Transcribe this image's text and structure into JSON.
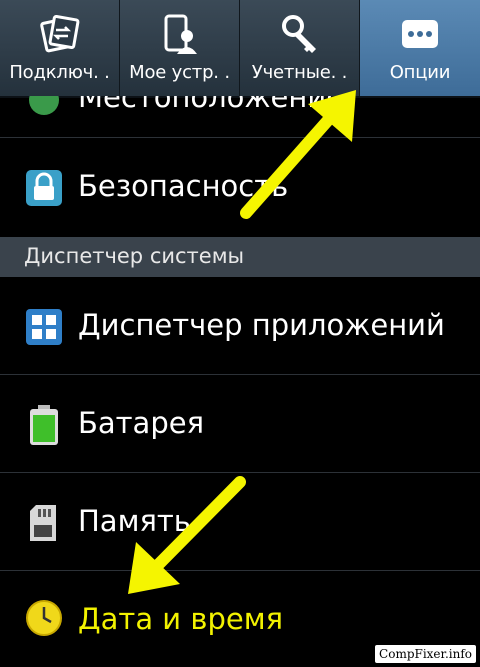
{
  "tabs": [
    {
      "label": "Подключ. .",
      "icon": "connections-icon"
    },
    {
      "label": "Мое устр. .",
      "icon": "my-device-icon"
    },
    {
      "label": "Учетные. .",
      "icon": "accounts-icon"
    },
    {
      "label": "Опции",
      "icon": "options-icon",
      "active": true
    }
  ],
  "list": {
    "partial_item": "Местоположение",
    "security": "Безопасность",
    "section_header": "Диспетчер системы",
    "app_manager": "Диспетчер приложений",
    "battery": "Батарея",
    "storage": "Память",
    "date_time": "Дата и время"
  },
  "watermark": "CompFixer.info",
  "colors": {
    "active_tab": "#4e7fae",
    "arrow": "#f5f500",
    "highlight_text": "#f2f200"
  }
}
